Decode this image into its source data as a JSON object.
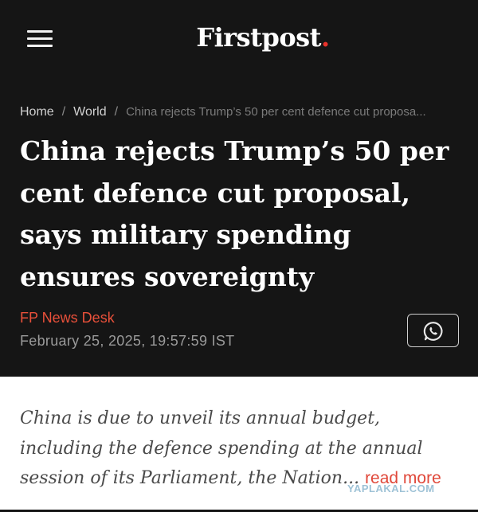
{
  "header": {
    "logo_text": "Firstpost",
    "logo_dot": ".",
    "menu_icon": "hamburger-menu-icon"
  },
  "breadcrumb": {
    "items": [
      "Home",
      "World"
    ],
    "separator": "/",
    "current": "China rejects Trump’s 50 per cent defence cut proposa..."
  },
  "article": {
    "title": "China rejects Trump’s 50 per cent defence cut proposal, says military spending ensures sovereignty",
    "author": "FP News Desk",
    "date": "February 25, 2025, 19:57:59 IST",
    "share_icon": "whatsapp-icon",
    "summary": "China is due to unveil its annual budget, including the defence spending at the annual session of its Parliament, the Nation",
    "summary_ellipsis": "...",
    "read_more": "read more"
  },
  "watermark": "YAPLAKAL.COM",
  "colors": {
    "background_dark": "#151515",
    "accent_red": "#e8322b",
    "author_orange": "#e8503a",
    "read_more": "#e0483a"
  }
}
